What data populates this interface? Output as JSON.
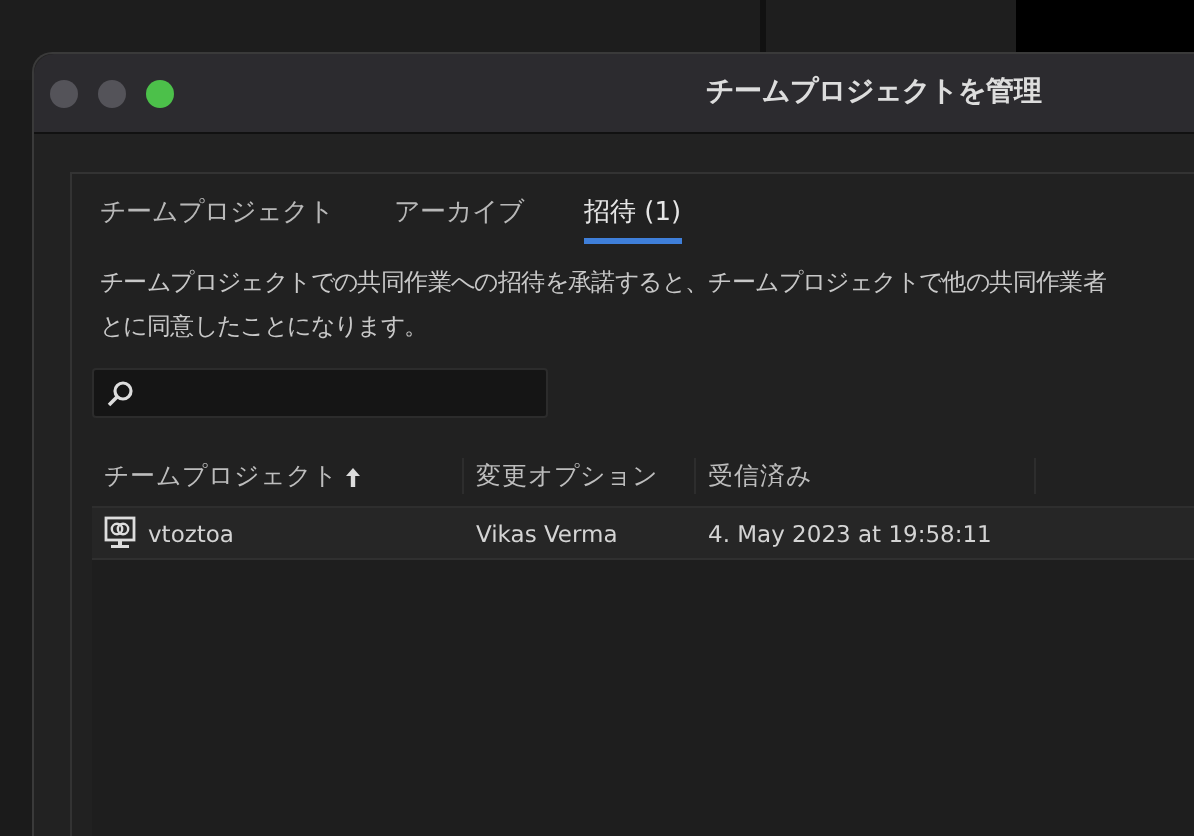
{
  "window": {
    "title": "チームプロジェクトを管理"
  },
  "tabs": [
    {
      "label": "チームプロジェクト",
      "selected": false
    },
    {
      "label": "アーカイブ",
      "selected": false
    },
    {
      "label": "招待 (1)",
      "selected": true
    }
  ],
  "description_lines": [
    "チームプロジェクトでの共同作業への招待を承諾すると、チームプロジェクトで他の共同作業者",
    "とに同意したことになります。"
  ],
  "table": {
    "columns": [
      {
        "label": "チームプロジェクト",
        "sorted": true
      },
      {
        "label": "変更オプション",
        "sorted": false
      },
      {
        "label": "受信済み",
        "sorted": false
      }
    ],
    "rows": [
      {
        "cells": [
          "vtoztoa",
          "Vikas Verma",
          "4. May 2023 at 19:58:11"
        ]
      }
    ]
  }
}
